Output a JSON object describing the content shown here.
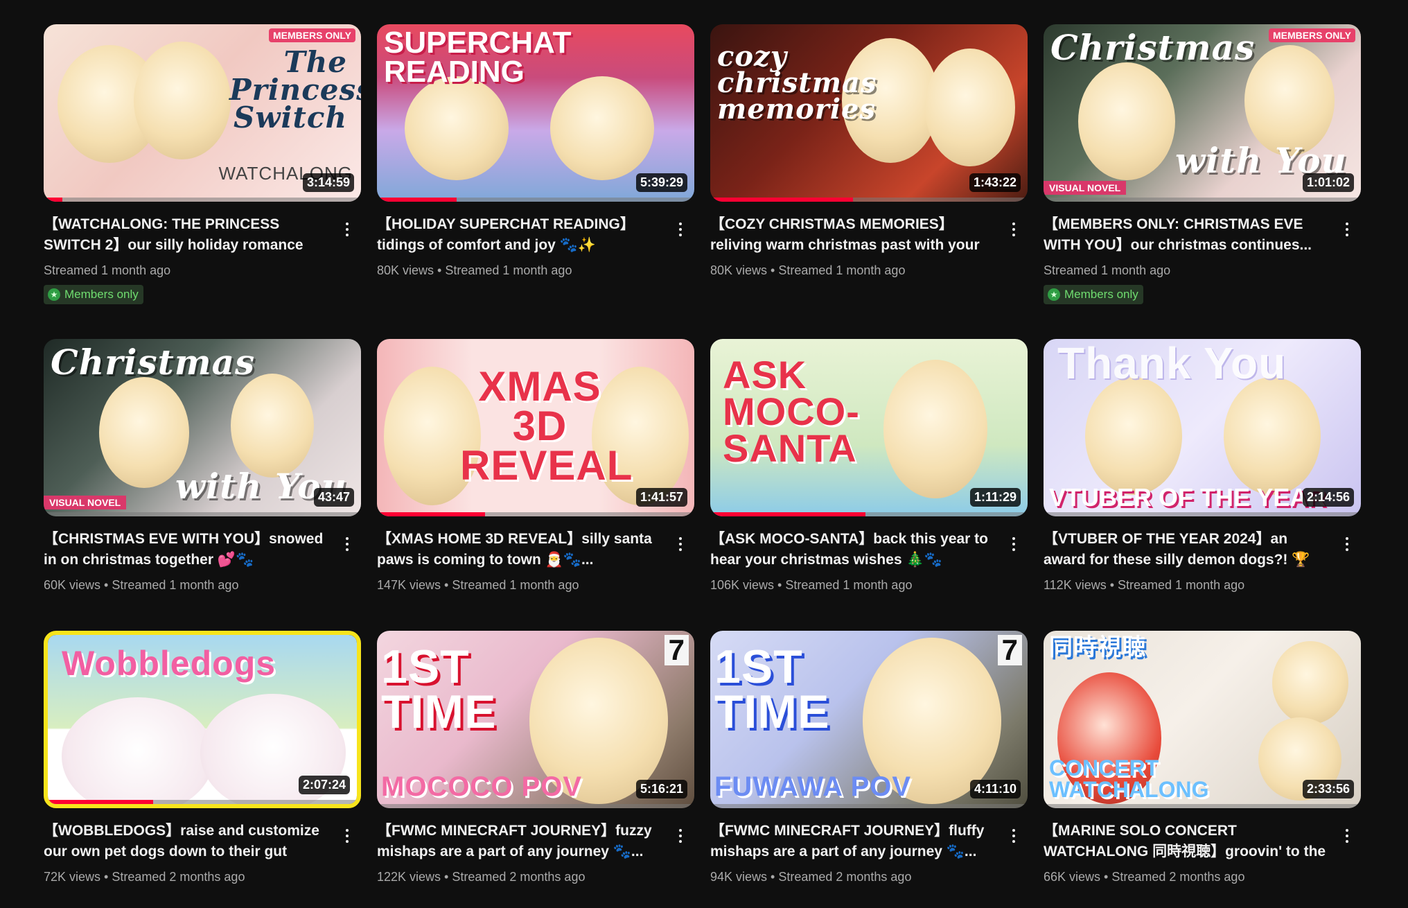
{
  "videos": [
    {
      "title": "【WATCHALONG: THE PRINCESS SWITCH 2】our silly holiday romance movie traditio...",
      "info": "Streamed 1 month ago",
      "members": "Members only",
      "duration": "3:14:59",
      "art1": "The Princess Switch",
      "art2": "WATCHALONG",
      "badge": "MEMBERS ONLY",
      "progress": 0.06
    },
    {
      "title": "【HOLIDAY SUPERCHAT READING】tidings of comfort and joy 🐾✨ 【FUWAMOCO】",
      "info": "80K views • Streamed 1 month ago",
      "duration": "5:39:29",
      "art1": "SUPERCHAT READING",
      "progress": 0.25
    },
    {
      "title": "【COZY CHRISTMAS MEMORIES】reliving warm christmas past with your stories 🎅...",
      "info": "80K views • Streamed 1 month ago",
      "duration": "1:43:22",
      "art1": "cozy christmas memories",
      "progress": 0.45
    },
    {
      "title": "【MEMBERS ONLY: CHRISTMAS EVE WITH YOU】our christmas continues... 💕🐾...",
      "info": "Streamed 1 month ago",
      "members": "Members only",
      "duration": "1:01:02",
      "art1": "Christmas",
      "art2": "with You",
      "badge": "MEMBERS ONLY",
      "vn": "VISUAL NOVEL",
      "progress": 0.0
    },
    {
      "title": "【CHRISTMAS EVE WITH YOU】snowed in on christmas together 💕🐾 【FUWAMOCO...",
      "info": "60K views • Streamed 1 month ago",
      "duration": "43:47",
      "art1": "Christmas",
      "art2": "with You",
      "vn": "VISUAL NOVEL",
      "progress": 0.0
    },
    {
      "title": "【XMAS HOME 3D REVEAL】silly santa paws is coming to town 🎅🐾...",
      "info": "147K views • Streamed 1 month ago",
      "duration": "1:41:57",
      "art1": "XMAS 3D REVEAL",
      "progress": 0.34
    },
    {
      "title": "【ASK MOCO-SANTA】back this year to hear your christmas wishes 🎄🐾 #shorts...",
      "info": "106K views • Streamed 1 month ago",
      "duration": "1:11:29",
      "art1": "ASK MOCO-SANTA",
      "progress": 0.49
    },
    {
      "title": "【VTUBER OF THE YEAR 2024】an award for these silly demon dogs?! 🏆🐾...",
      "info": "112K views • Streamed 1 month ago",
      "duration": "2:14:56",
      "art1": "Thank You",
      "art2": "VTUBER OF THE YEAR",
      "progress": 0.0
    },
    {
      "title": "【WOBBLEDOGS】raise and customize our own pet dogs down to their gut biome 🐾...",
      "info": "72K views • Streamed 2 months ago",
      "duration": "2:07:24",
      "art1": "Wobbledogs",
      "progress": 0.34
    },
    {
      "title": "【FWMC MINECRAFT JOURNEY】fuzzy mishaps are a part of any journey 🐾...",
      "info": "122K views • Streamed 2 months ago",
      "duration": "5:16:21",
      "art1": "1ST TIME",
      "art2": "MOCOCO POV",
      "seven": "7",
      "progress": 0.0
    },
    {
      "title": "【FWMC MINECRAFT JOURNEY】fluffy mishaps are a part of any journey 🐾...",
      "info": "94K views • Streamed 2 months ago",
      "duration": "4:11:10",
      "art1": "1ST TIME",
      "art2": "FUWAWA POV",
      "seven": "7",
      "progress": 0.0
    },
    {
      "title": "【MARINE SOLO CONCERT WATCHALONG 同時視聴】groovin' to the pirate disco 🏴‍☠️🐾...",
      "info": "66K views • Streamed 2 months ago",
      "duration": "2:33:56",
      "art1": "同時視聴",
      "art2": "CONCERT WATCHALONG",
      "progress": 0.0
    }
  ]
}
